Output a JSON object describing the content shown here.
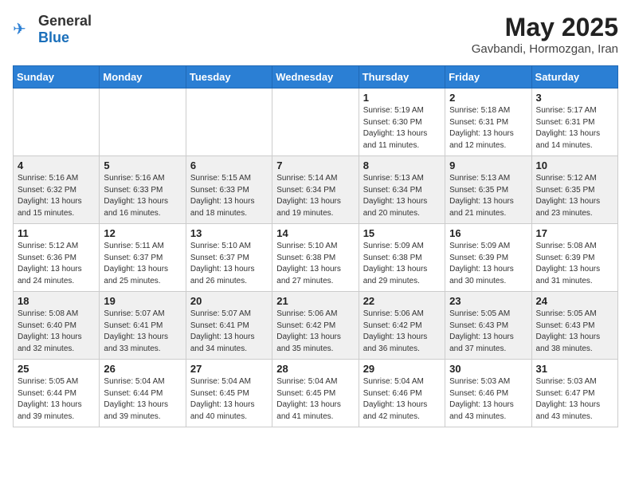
{
  "header": {
    "logo_general": "General",
    "logo_blue": "Blue",
    "month_year": "May 2025",
    "location": "Gavbandi, Hormozgan, Iran"
  },
  "weekdays": [
    "Sunday",
    "Monday",
    "Tuesday",
    "Wednesday",
    "Thursday",
    "Friday",
    "Saturday"
  ],
  "rows": [
    [
      {
        "day": "",
        "info": ""
      },
      {
        "day": "",
        "info": ""
      },
      {
        "day": "",
        "info": ""
      },
      {
        "day": "",
        "info": ""
      },
      {
        "day": "1",
        "info": "Sunrise: 5:19 AM\nSunset: 6:30 PM\nDaylight: 13 hours\nand 11 minutes."
      },
      {
        "day": "2",
        "info": "Sunrise: 5:18 AM\nSunset: 6:31 PM\nDaylight: 13 hours\nand 12 minutes."
      },
      {
        "day": "3",
        "info": "Sunrise: 5:17 AM\nSunset: 6:31 PM\nDaylight: 13 hours\nand 14 minutes."
      }
    ],
    [
      {
        "day": "4",
        "info": "Sunrise: 5:16 AM\nSunset: 6:32 PM\nDaylight: 13 hours\nand 15 minutes."
      },
      {
        "day": "5",
        "info": "Sunrise: 5:16 AM\nSunset: 6:33 PM\nDaylight: 13 hours\nand 16 minutes."
      },
      {
        "day": "6",
        "info": "Sunrise: 5:15 AM\nSunset: 6:33 PM\nDaylight: 13 hours\nand 18 minutes."
      },
      {
        "day": "7",
        "info": "Sunrise: 5:14 AM\nSunset: 6:34 PM\nDaylight: 13 hours\nand 19 minutes."
      },
      {
        "day": "8",
        "info": "Sunrise: 5:13 AM\nSunset: 6:34 PM\nDaylight: 13 hours\nand 20 minutes."
      },
      {
        "day": "9",
        "info": "Sunrise: 5:13 AM\nSunset: 6:35 PM\nDaylight: 13 hours\nand 21 minutes."
      },
      {
        "day": "10",
        "info": "Sunrise: 5:12 AM\nSunset: 6:35 PM\nDaylight: 13 hours\nand 23 minutes."
      }
    ],
    [
      {
        "day": "11",
        "info": "Sunrise: 5:12 AM\nSunset: 6:36 PM\nDaylight: 13 hours\nand 24 minutes."
      },
      {
        "day": "12",
        "info": "Sunrise: 5:11 AM\nSunset: 6:37 PM\nDaylight: 13 hours\nand 25 minutes."
      },
      {
        "day": "13",
        "info": "Sunrise: 5:10 AM\nSunset: 6:37 PM\nDaylight: 13 hours\nand 26 minutes."
      },
      {
        "day": "14",
        "info": "Sunrise: 5:10 AM\nSunset: 6:38 PM\nDaylight: 13 hours\nand 27 minutes."
      },
      {
        "day": "15",
        "info": "Sunrise: 5:09 AM\nSunset: 6:38 PM\nDaylight: 13 hours\nand 29 minutes."
      },
      {
        "day": "16",
        "info": "Sunrise: 5:09 AM\nSunset: 6:39 PM\nDaylight: 13 hours\nand 30 minutes."
      },
      {
        "day": "17",
        "info": "Sunrise: 5:08 AM\nSunset: 6:39 PM\nDaylight: 13 hours\nand 31 minutes."
      }
    ],
    [
      {
        "day": "18",
        "info": "Sunrise: 5:08 AM\nSunset: 6:40 PM\nDaylight: 13 hours\nand 32 minutes."
      },
      {
        "day": "19",
        "info": "Sunrise: 5:07 AM\nSunset: 6:41 PM\nDaylight: 13 hours\nand 33 minutes."
      },
      {
        "day": "20",
        "info": "Sunrise: 5:07 AM\nSunset: 6:41 PM\nDaylight: 13 hours\nand 34 minutes."
      },
      {
        "day": "21",
        "info": "Sunrise: 5:06 AM\nSunset: 6:42 PM\nDaylight: 13 hours\nand 35 minutes."
      },
      {
        "day": "22",
        "info": "Sunrise: 5:06 AM\nSunset: 6:42 PM\nDaylight: 13 hours\nand 36 minutes."
      },
      {
        "day": "23",
        "info": "Sunrise: 5:05 AM\nSunset: 6:43 PM\nDaylight: 13 hours\nand 37 minutes."
      },
      {
        "day": "24",
        "info": "Sunrise: 5:05 AM\nSunset: 6:43 PM\nDaylight: 13 hours\nand 38 minutes."
      }
    ],
    [
      {
        "day": "25",
        "info": "Sunrise: 5:05 AM\nSunset: 6:44 PM\nDaylight: 13 hours\nand 39 minutes."
      },
      {
        "day": "26",
        "info": "Sunrise: 5:04 AM\nSunset: 6:44 PM\nDaylight: 13 hours\nand 39 minutes."
      },
      {
        "day": "27",
        "info": "Sunrise: 5:04 AM\nSunset: 6:45 PM\nDaylight: 13 hours\nand 40 minutes."
      },
      {
        "day": "28",
        "info": "Sunrise: 5:04 AM\nSunset: 6:45 PM\nDaylight: 13 hours\nand 41 minutes."
      },
      {
        "day": "29",
        "info": "Sunrise: 5:04 AM\nSunset: 6:46 PM\nDaylight: 13 hours\nand 42 minutes."
      },
      {
        "day": "30",
        "info": "Sunrise: 5:03 AM\nSunset: 6:46 PM\nDaylight: 13 hours\nand 43 minutes."
      },
      {
        "day": "31",
        "info": "Sunrise: 5:03 AM\nSunset: 6:47 PM\nDaylight: 13 hours\nand 43 minutes."
      }
    ]
  ]
}
